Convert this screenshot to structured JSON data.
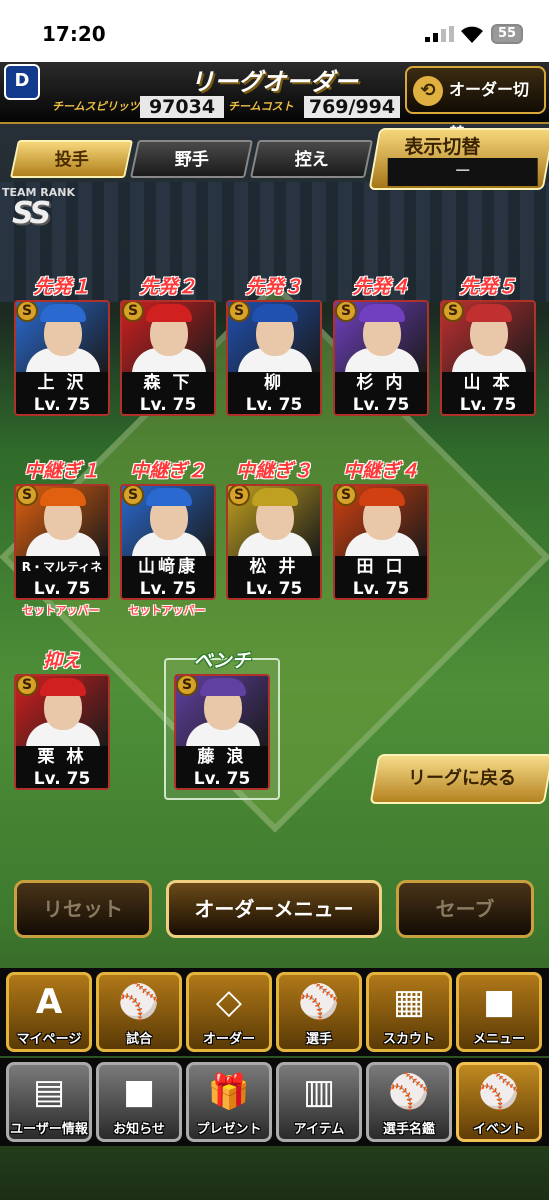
{
  "status": {
    "time": "17:20",
    "battery": "55"
  },
  "header": {
    "team_logo": "D",
    "title": "リーグオーダー",
    "team_spirits_label": "チームスピリッツ",
    "team_spirits": "97034",
    "team_cost_label": "チームコスト",
    "team_cost": "769/994",
    "order_switch": "オーダー切替"
  },
  "tabs": [
    {
      "label": "投手",
      "active": true
    },
    {
      "label": "野手",
      "active": false
    },
    {
      "label": "控え",
      "active": false
    }
  ],
  "view_switch": {
    "label": "表示切替",
    "value": "－"
  },
  "team_rank": {
    "label": "TEAM RANK",
    "value": "SS"
  },
  "starters": [
    {
      "slot": "先発１",
      "name": "上 沢",
      "level": "Lv. 75",
      "color": "#2a6ad0"
    },
    {
      "slot": "先発２",
      "name": "森 下",
      "level": "Lv. 75",
      "color": "#d02020"
    },
    {
      "slot": "先発３",
      "name": "柳",
      "level": "Lv. 75",
      "color": "#2050b0"
    },
    {
      "slot": "先発４",
      "name": "杉 内",
      "level": "Lv. 75",
      "color": "#7040c0"
    },
    {
      "slot": "先発５",
      "name": "山 本",
      "level": "Lv. 75",
      "color": "#c03030"
    }
  ],
  "relievers": [
    {
      "slot": "中継ぎ１",
      "name": "R・マルティネス",
      "level": "Lv. 75",
      "role": "セットアッパー",
      "color": "#e06010"
    },
    {
      "slot": "中継ぎ２",
      "name": "山﨑康",
      "level": "Lv. 75",
      "role": "セットアッパー",
      "color": "#2a6ad0"
    },
    {
      "slot": "中継ぎ３",
      "name": "松 井",
      "level": "Lv. 75",
      "role": "",
      "color": "#c0a020"
    },
    {
      "slot": "中継ぎ４",
      "name": "田 口",
      "level": "Lv. 75",
      "role": "",
      "color": "#d04010"
    }
  ],
  "closer": {
    "slot": "抑え",
    "name": "栗 林",
    "level": "Lv. 75",
    "color": "#d02020"
  },
  "bench": {
    "slot": "ベンチ",
    "name": "藤 浪",
    "level": "Lv. 75",
    "color": "#6040a0"
  },
  "back_to_league": "リーグに戻る",
  "actions": {
    "reset": "リセット",
    "order_menu": "オーダーメニュー",
    "save": "セーブ"
  },
  "menu_row1": [
    {
      "label": "マイページ",
      "icon": "A"
    },
    {
      "label": "試合",
      "icon": "⚾"
    },
    {
      "label": "オーダー",
      "icon": "◇"
    },
    {
      "label": "選手",
      "icon": "⚾"
    },
    {
      "label": "スカウト",
      "icon": "▦"
    },
    {
      "label": "メニュー",
      "icon": "■"
    }
  ],
  "menu_row2": [
    {
      "label": "ユーザー情報",
      "icon": "▤"
    },
    {
      "label": "お知らせ",
      "icon": "■"
    },
    {
      "label": "プレゼント",
      "icon": "🎁"
    },
    {
      "label": "アイテム",
      "icon": "▥"
    },
    {
      "label": "選手名鑑",
      "icon": "⚾"
    },
    {
      "label": "イベント",
      "icon": "⚾"
    }
  ]
}
